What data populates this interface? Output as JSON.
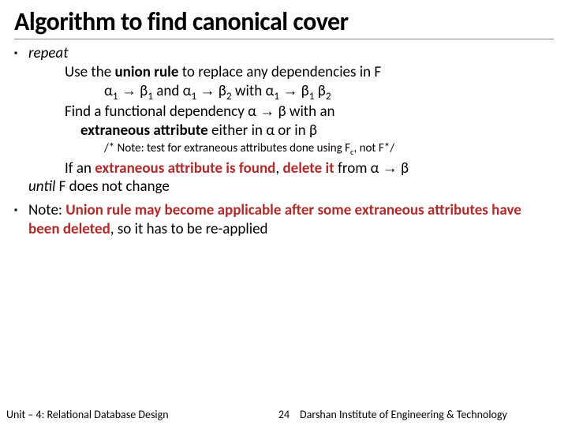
{
  "title": "Algorithm to find canonical cover",
  "bullets": {
    "repeat": "repeat",
    "line_union_1": "Use the ",
    "line_union_bold": "union rule",
    "line_union_2": " to replace any dependencies in F",
    "line_rule": "α₁ → β₁ and α₁ → β₂ with α₁ → β₁ β₂",
    "line_find_1": "Find a functional dependency α → β with an",
    "line_find_bold": "extraneous attribute",
    "line_find_2": " either in α or in β",
    "note_1": "/* Note: test for extraneous attributes done using F",
    "note_sub": "c",
    "note_2": ", not F*/",
    "line_if_1": "If an ",
    "line_if_bold": "extraneous attribute is found",
    "line_if_2": ", ",
    "line_if_bold2": "delete it",
    "line_if_3": " from α → β",
    "until_1": "until",
    "until_2": " F does not change",
    "note2_1": "Note: ",
    "note2_bold": "Union rule may become applicable after some extraneous attributes have been deleted",
    "note2_2": ", so it has to be re-applied"
  },
  "footer": {
    "left": "Unit – 4: Relational Database Design",
    "page": "24",
    "right": "Darshan Institute of Engineering & Technology"
  }
}
